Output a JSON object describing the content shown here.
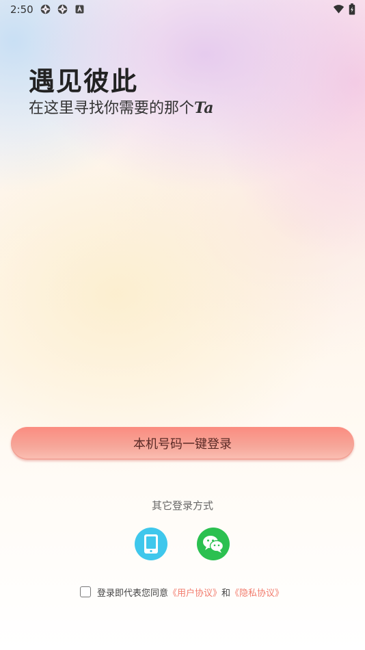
{
  "status_bar": {
    "time": "2:50",
    "left_icons": [
      "aperture-icon",
      "aperture-icon",
      "a-letter-icon"
    ],
    "right_icons": [
      "wifi-icon",
      "battery-icon"
    ]
  },
  "hero": {
    "title": "遇见彼此",
    "subtitle": "在这里寻找你需要的那个",
    "subtitle_emphasis": "Ta"
  },
  "login": {
    "one_click_label": "本机号码一键登录",
    "other_methods_label": "其它登录方式",
    "methods": [
      {
        "name": "phone",
        "icon": "phone-icon",
        "color": "#3fc7ec"
      },
      {
        "name": "wechat",
        "icon": "wechat-icon",
        "color": "#2bc050"
      }
    ]
  },
  "agreement": {
    "checked": false,
    "prefix": "登录即代表您同意",
    "user_agreement": "《用户协议》",
    "conjunction": "和",
    "privacy_policy": "《隐私协议》",
    "link_color": "#f27c6d"
  },
  "colors": {
    "accent": "#fb8c80",
    "phone": "#3fc7ec",
    "wechat": "#2bc050"
  }
}
